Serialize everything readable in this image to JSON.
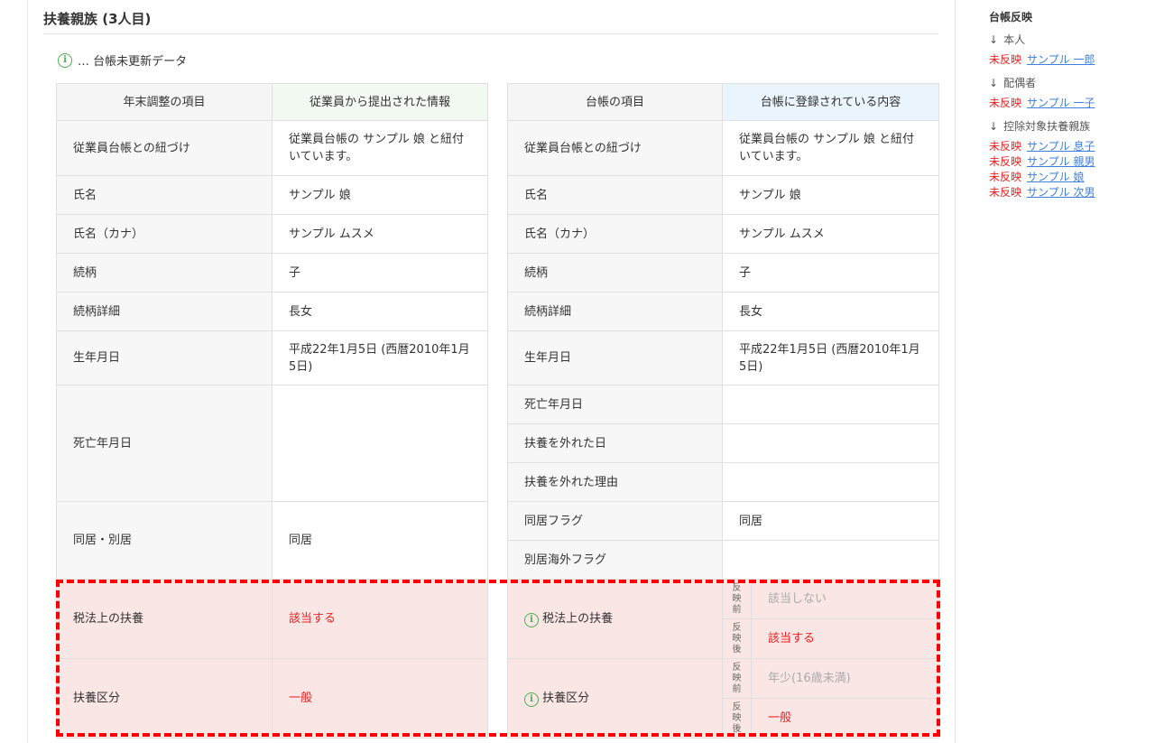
{
  "title": "扶養親族 (3人目)",
  "legend": "… 台帳未更新データ",
  "left": {
    "headers": [
      "年末調整の項目",
      "従業員から提出された情報"
    ],
    "rows": [
      [
        "従業員台帳との紐づけ",
        "従業員台帳の サンプル 娘 と紐付いています。"
      ],
      [
        "氏名",
        "サンプル 娘"
      ],
      [
        "氏名（カナ）",
        "サンプル ムスメ"
      ],
      [
        "続柄",
        "子"
      ],
      [
        "続柄詳細",
        "長女"
      ],
      [
        "生年月日",
        "平成22年1月5日 (西暦2010年1月5日)"
      ],
      [
        "死亡年月日",
        ""
      ],
      [
        "同居・別居",
        "同居"
      ],
      [
        "税法上の扶養",
        "該当する"
      ],
      [
        "扶養区分",
        "一般"
      ]
    ]
  },
  "right": {
    "headers": [
      "台帳の項目",
      "台帳に登録されている内容"
    ],
    "rows": [
      [
        "従業員台帳との紐づけ",
        "従業員台帳の サンプル 娘 と紐付いています。"
      ],
      [
        "氏名",
        "サンプル 娘"
      ],
      [
        "氏名（カナ）",
        "サンプル ムスメ"
      ],
      [
        "続柄",
        "子"
      ],
      [
        "続柄詳細",
        "長女"
      ],
      [
        "生年月日",
        "平成22年1月5日 (西暦2010年1月5日)"
      ],
      [
        "死亡年月日",
        ""
      ],
      [
        "扶養を外れた日",
        ""
      ],
      [
        "扶養を外れた理由",
        ""
      ],
      [
        "同居フラグ",
        "同居"
      ],
      [
        "別居海外フラグ",
        ""
      ]
    ],
    "before_label": "反映前",
    "after_label": "反映後",
    "diff": [
      {
        "label": "税法上の扶養",
        "before": "該当しない",
        "after": "該当する"
      },
      {
        "label": "扶養区分",
        "before": "年少(16歳未満)",
        "after": "一般"
      }
    ]
  },
  "sidebar": {
    "title": "台帳反映",
    "status": "未反映",
    "groups": [
      {
        "label": "本人",
        "links": [
          "サンプル 一郎"
        ]
      },
      {
        "label": "配偶者",
        "links": [
          "サンプル 一子"
        ]
      },
      {
        "label": "控除対象扶養親族",
        "links": [
          "サンプル 息子",
          "サンプル 親男",
          "サンプル 娘",
          "サンプル 次男"
        ]
      }
    ]
  },
  "colors": {
    "accent_red": "#f01e1e",
    "link": "#3d7fdc",
    "info": "#4caf50"
  }
}
